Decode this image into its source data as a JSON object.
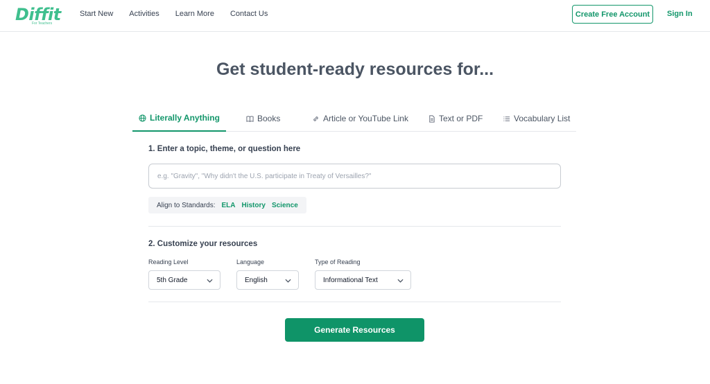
{
  "header": {
    "logo_text": "Diffit",
    "logo_sub": "For Teachers",
    "nav": [
      "Start New",
      "Activities",
      "Learn More",
      "Contact Us"
    ],
    "create_account": "Create Free Account",
    "sign_in": "Sign In"
  },
  "title": "Get student-ready resources for...",
  "tabs": [
    {
      "label": "Literally Anything",
      "icon": "globe-icon",
      "active": true
    },
    {
      "label": "Books",
      "icon": "book-icon",
      "active": false
    },
    {
      "label": "Article or YouTube Link",
      "icon": "link-icon",
      "active": false
    },
    {
      "label": "Text or PDF",
      "icon": "document-icon",
      "active": false
    },
    {
      "label": "Vocabulary List",
      "icon": "list-icon",
      "active": false
    }
  ],
  "section1": {
    "label": "1. Enter a topic, theme, or question here",
    "input_placeholder": "e.g. \"Gravity\", \"Why didn't the U.S. participate in Treaty of Versailles?\"",
    "input_value": "",
    "standards_label": "Align to Standards:",
    "standards": [
      "ELA",
      "History",
      "Science"
    ]
  },
  "section2": {
    "label": "2. Customize your resources",
    "reading_level_label": "Reading Level",
    "reading_level_value": "5th Grade",
    "language_label": "Language",
    "language_value": "English",
    "reading_type_label": "Type of Reading",
    "reading_type_value": "Informational Text"
  },
  "generate_label": "Generate Resources",
  "colors": {
    "brand_green": "#12966a",
    "logo_green": "#3fbf8e",
    "button_green": "#0f9468"
  }
}
